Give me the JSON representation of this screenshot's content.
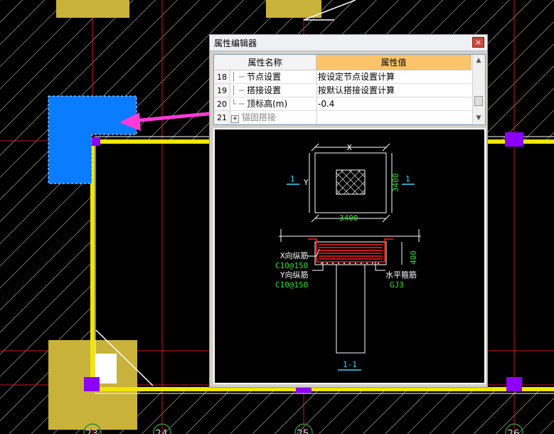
{
  "axis_labels": [
    "23",
    "24",
    "25",
    "26"
  ],
  "dialog": {
    "title": "属性编辑器",
    "close_glyph": "×",
    "columns": {
      "name": "属性名称",
      "value": "属性值"
    },
    "rows": [
      {
        "num": "18",
        "name": "节点设置",
        "value": "按设定节点设置计算"
      },
      {
        "num": "19",
        "name": "搭接设置",
        "value": "按默认搭接设置计算"
      },
      {
        "num": "20",
        "name": "顶标高(m)",
        "value": "-0.4"
      },
      {
        "num": "21",
        "name": "锚固搭接",
        "value": "",
        "expand": "+"
      }
    ],
    "scroll_up": "▲",
    "scroll_down": "▼"
  },
  "drawing": {
    "x_label": "X",
    "y_label": "Y",
    "section_mark": "1",
    "width_dim": "3400",
    "height_dim": "3400",
    "depth_dim": "400",
    "x_rebar_label": "X向纵筋",
    "x_rebar_spec": "C10@150",
    "y_rebar_label": "Y向纵筋",
    "y_rebar_spec": "C10@150",
    "stirrup_label": "水平箍筋",
    "stirrup_spec": "GJ3",
    "section_title": "1-1"
  },
  "colors": {
    "selected_column": "#0a7cff",
    "beam": "#f0e600",
    "column_fill": "#c9b23a",
    "axis_line": "#d0102a",
    "arrow": "#ff3ad8",
    "node_marker": "#8c00ff",
    "rebar_red": "#ff2020",
    "dim_green": "#30e030",
    "label_cyan": "#3ad7ff"
  }
}
